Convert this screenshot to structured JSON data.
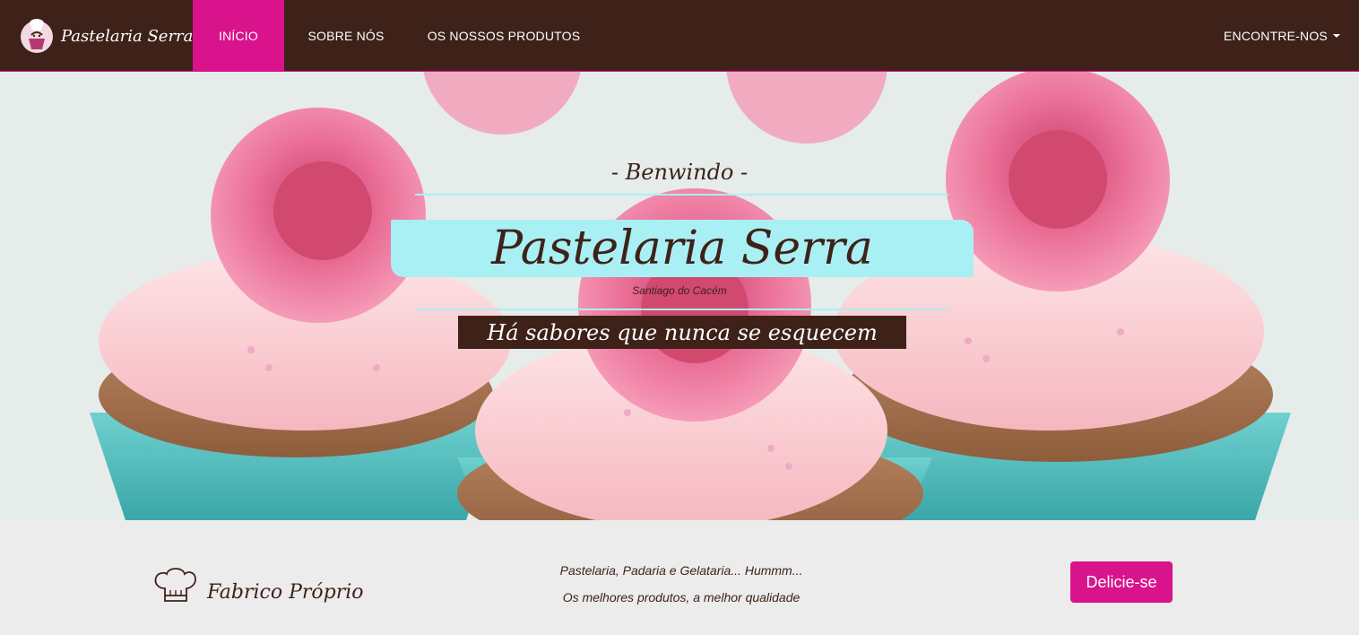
{
  "colors": {
    "brand_brown": "#3e2219",
    "accent_pink": "#d9138c",
    "accent_cyan": "#a9f0f4"
  },
  "navbar": {
    "brand_name": "Pastelaria Serra",
    "logo_icon": "chef-cupcake-logo-icon",
    "items": [
      {
        "label": "INÍCIO",
        "active": true
      },
      {
        "label": "SOBRE NÓS",
        "active": false
      },
      {
        "label": "OS NOSSOS PRODUTOS",
        "active": false
      }
    ],
    "dropdown_label": "ENCONTRE-NOS",
    "dropdown_icon": "caret-down-icon"
  },
  "hero": {
    "welcome": "- Benwindo -",
    "title": "Pastelaria Serra",
    "location": "Santiago do Cacém",
    "slogan": "Há sabores que nunca se esquecem",
    "background_image": "cupcakes-with-pink-roses"
  },
  "feature": {
    "icon": "chef-hat-icon",
    "label": "Fabrico Próprio",
    "tagline_1": "Pastelaria, Padaria e Gelataria... Hummm...",
    "tagline_2": "Os melhores produtos, a melhor qualidade",
    "button_label": "Delicie-se"
  }
}
